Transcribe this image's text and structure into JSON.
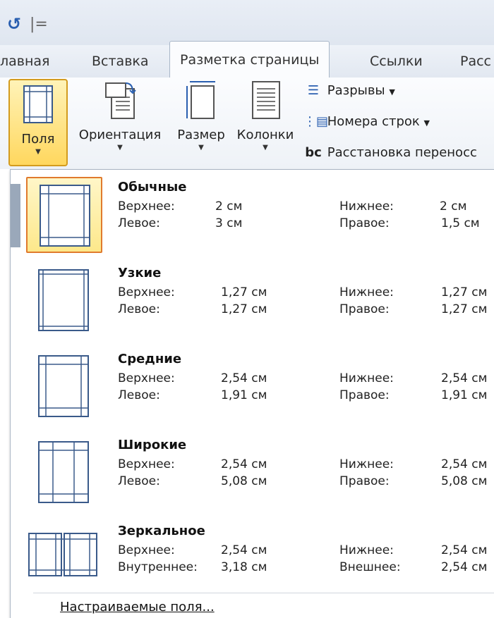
{
  "qat": {
    "undo_icon": "undo-icon",
    "separator": "|="
  },
  "tabs": [
    {
      "label": "лавная"
    },
    {
      "label": "Вставка"
    },
    {
      "label": "Разметка страницы",
      "active": true
    },
    {
      "label": "Ссылки"
    },
    {
      "label": "Расс"
    }
  ],
  "ribbon": {
    "margins": {
      "label": "Поля"
    },
    "orientation": {
      "label": "Ориентация"
    },
    "size": {
      "label": "Размер"
    },
    "columns": {
      "label": "Колонки"
    },
    "breaks": {
      "label": "Разрывы"
    },
    "line_numbers": {
      "label": "Номера строк"
    },
    "hyphenation": {
      "label": "Расстановка переносс",
      "icon_text": "bc"
    }
  },
  "presets": [
    {
      "title": "Обычные",
      "top_label": "Верхнее:",
      "top_value": "2 см",
      "bottom_label": "Нижнее:",
      "bottom_value": "2 см",
      "left_label": "Левое:",
      "left_value": "3 см",
      "right_label": "Правое:",
      "right_value": "1,5 см"
    },
    {
      "title": "Узкие",
      "top_label": "Верхнее:",
      "top_value": "1,27 см",
      "bottom_label": "Нижнее:",
      "bottom_value": "1,27 см",
      "left_label": "Левое:",
      "left_value": "1,27 см",
      "right_label": "Правое:",
      "right_value": "1,27 см"
    },
    {
      "title": "Средние",
      "top_label": "Верхнее:",
      "top_value": "2,54 см",
      "bottom_label": "Нижнее:",
      "bottom_value": "2,54 см",
      "left_label": "Левое:",
      "left_value": "1,91 см",
      "right_label": "Правое:",
      "right_value": "1,91 см"
    },
    {
      "title": "Широкие",
      "top_label": "Верхнее:",
      "top_value": "2,54 см",
      "bottom_label": "Нижнее:",
      "bottom_value": "2,54 см",
      "left_label": "Левое:",
      "left_value": "5,08 см",
      "right_label": "Правое:",
      "right_value": "5,08 см"
    },
    {
      "title": "Зеркальное",
      "top_label": "Верхнее:",
      "top_value": "2,54 см",
      "bottom_label": "Нижнее:",
      "bottom_value": "2,54 см",
      "left_label": "Внутреннее:",
      "left_value": "3,18 см",
      "right_label": "Внешнее:",
      "right_value": "2,54 см"
    }
  ],
  "footer": {
    "custom_margins": "Настраиваемые поля..."
  },
  "colors": {
    "selected_border": "#e07a2d",
    "selected_fill": "#fde88b",
    "accent": "#2a5fb0"
  }
}
